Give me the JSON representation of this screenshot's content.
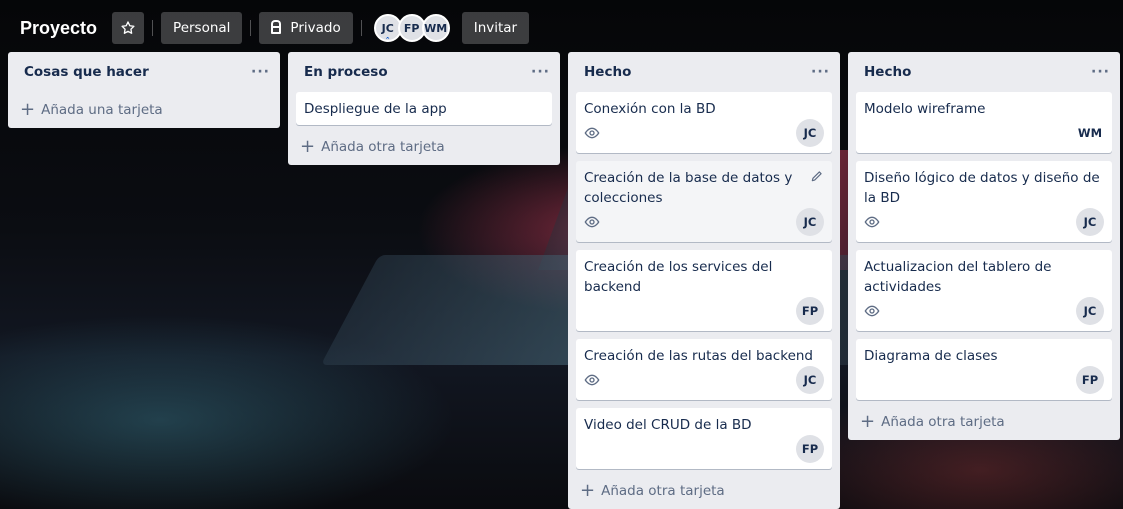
{
  "board": {
    "title": "Proyecto",
    "workspace_label": "Personal",
    "visibility_label": "Privado",
    "invite_label": "Invitar",
    "members": [
      "JC",
      "FP",
      "WM"
    ]
  },
  "lists": [
    {
      "title": "Cosas que hacer",
      "menu": "···",
      "add_label": "Añada una tarjeta",
      "cards": []
    },
    {
      "title": "En proceso",
      "menu": "···",
      "add_label": "Añada otra tarjeta",
      "cards": [
        {
          "title": "Despliegue de la app"
        }
      ]
    },
    {
      "title": "Hecho",
      "menu": "···",
      "add_label": "Añada otra tarjeta",
      "cards": [
        {
          "title": "Conexión con la BD",
          "watch": true,
          "member": "JC"
        },
        {
          "title": "Creación de la base de datos y colecciones",
          "watch": true,
          "member": "JC"
        },
        {
          "title": "Creación de los services del backend",
          "member": "FP"
        },
        {
          "title": "Creación de las rutas del backend",
          "watch": true,
          "member": "JC"
        },
        {
          "title": "Video del CRUD de la BD",
          "member": "FP"
        }
      ]
    },
    {
      "title": "Hecho",
      "menu": "···",
      "add_label": "Añada otra tarjeta",
      "cards": [
        {
          "title": "Modelo wireframe",
          "member": "WM"
        },
        {
          "title": "Diseño lógico de datos y diseño de la BD",
          "watch": true,
          "member": "JC"
        },
        {
          "title": "Actualizacion del tablero de actividades",
          "watch": true,
          "member": "JC"
        },
        {
          "title": "Diagrama de clases",
          "member": "FP"
        }
      ]
    }
  ]
}
